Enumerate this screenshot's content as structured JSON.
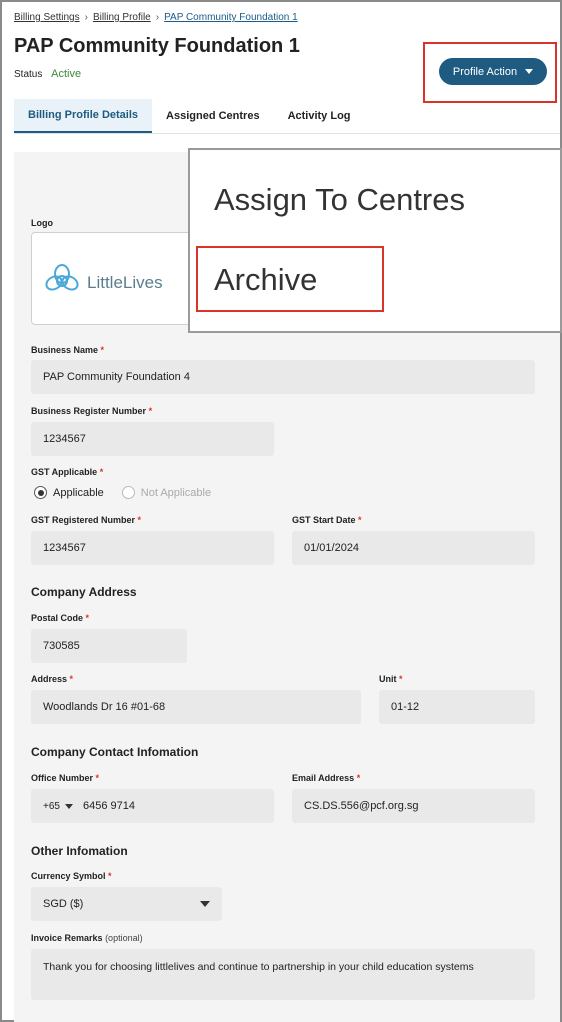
{
  "breadcrumb": {
    "items": [
      "Billing Settings",
      "Billing Profile",
      "PAP Community Foundation 1"
    ]
  },
  "header": {
    "title": "PAP Community Foundation 1",
    "status_label": "Status",
    "status_value": "Active",
    "profile_action_label": "Profile Action"
  },
  "tabs": [
    {
      "label": "Billing Profile Details",
      "active": true
    },
    {
      "label": "Assigned Centres",
      "active": false
    },
    {
      "label": "Activity Log",
      "active": false
    }
  ],
  "dropdown_menu": {
    "items": [
      "Assign To Centres",
      "Archive"
    ]
  },
  "form": {
    "logo_label": "Logo",
    "logo_text": "LittleLives",
    "business_name_label": "Business Name",
    "business_name_value": "PAP Community Foundation 4",
    "business_reg_label": "Business Register Number",
    "business_reg_value": "1234567",
    "gst_applicable_label": "GST Applicable",
    "gst_option_applicable": "Applicable",
    "gst_option_not_applicable": "Not Applicable",
    "gst_reg_label": "GST Registered Number",
    "gst_reg_value": "1234567",
    "gst_start_label": "GST Start Date",
    "gst_start_value": "01/01/2024",
    "company_address_title": "Company Address",
    "postal_code_label": "Postal Code",
    "postal_code_value": "730585",
    "address_label": "Address",
    "address_value": "Woodlands Dr 16 #01-68",
    "unit_label": "Unit",
    "unit_value": "01-12",
    "contact_title": "Company Contact Infomation",
    "office_number_label": "Office Number",
    "country_code": "+65",
    "office_number_value": "6456 9714",
    "email_label": "Email Address",
    "email_value": "CS.DS.556@pcf.org.sg",
    "other_title": "Other Infomation",
    "currency_label": "Currency Symbol",
    "currency_value": "SGD ($)",
    "remarks_label": "Invoice Remarks",
    "remarks_optional": "(optional)",
    "remarks_value": "Thank you for choosing littlelives and continue to partnership in your child education systems"
  },
  "colors": {
    "accent": "#1f5b80",
    "status_active": "#3a8a3a",
    "highlight_box": "#d9342b",
    "required": "#d9342b"
  }
}
